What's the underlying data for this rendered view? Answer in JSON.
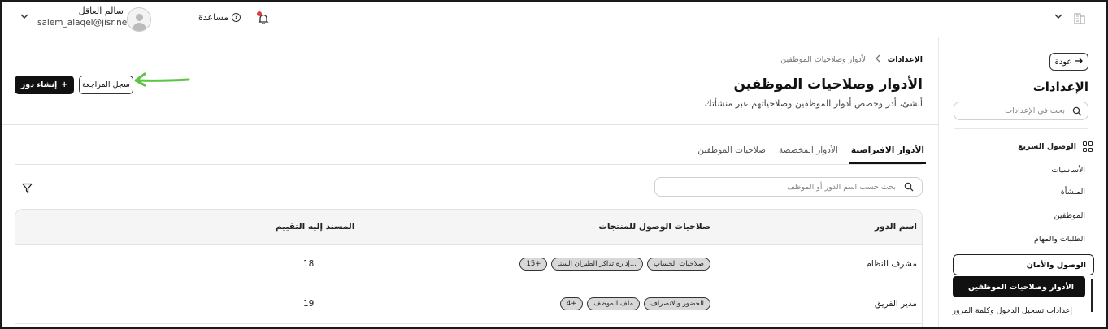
{
  "topbar": {
    "user_name": "سالم العاقل",
    "user_email": "salem_alaqel@jisr.net",
    "help_label": "مساعدة",
    "icons": [
      "chevron-down-icon",
      "avatar-icon",
      "help-icon",
      "bell-icon",
      "building-icon"
    ],
    "notification_dot_color": "#e23b3b"
  },
  "sidebar": {
    "back_label": "عودة",
    "title": "الإعدادات",
    "search_placeholder": "بحث في الإعدادات",
    "quick_access": "الوصول السريع",
    "section_basics": "الأساسيات",
    "items": [
      "المنشأة",
      "الموظفين",
      "الطلبات والمهام"
    ],
    "active_group": "الوصول والأمان",
    "active_sub": "الأدوار وصلاحيات الموظفين",
    "sub_item": "إعدادات تسجيل الدخول وكلمة المرور"
  },
  "header": {
    "breadcrumb_root": "الإعدادات",
    "breadcrumb_current": "الأدوار وصلاحيات الموظفين",
    "title": "الأدوار وصلاحيات الموظفين",
    "subtitle": "أنشئ، أدر وخصص أدوار الموظفين وصلاحياتهم عبر منشأتك",
    "create_label": "إنشاء دور",
    "audit_label": "سجل المراجعة",
    "annotation_arrow_color": "#5ec445"
  },
  "tabs": [
    "الأدوار الافتراضية",
    "الأدوار المخصصة",
    "صلاحيات الموظفين"
  ],
  "search_placeholder": "بحث حسب اسم الدور أو الموظف",
  "table": {
    "headers": {
      "name": "اسم الدور",
      "access": "صلاحيات الوصول للمنتجات",
      "assigned": "المسند إليه التقييم"
    },
    "rows": [
      {
        "name": "مشرف النظام",
        "chips": [
          "صلاحيات الحساب",
          "إدارة تذاكر الطيران السنـ...",
          "15+"
        ],
        "count": "18"
      },
      {
        "name": "مدير الفريق",
        "chips": [
          "الحضور والانصراف",
          "ملف الموظف",
          "4+"
        ],
        "count": "19"
      }
    ]
  }
}
